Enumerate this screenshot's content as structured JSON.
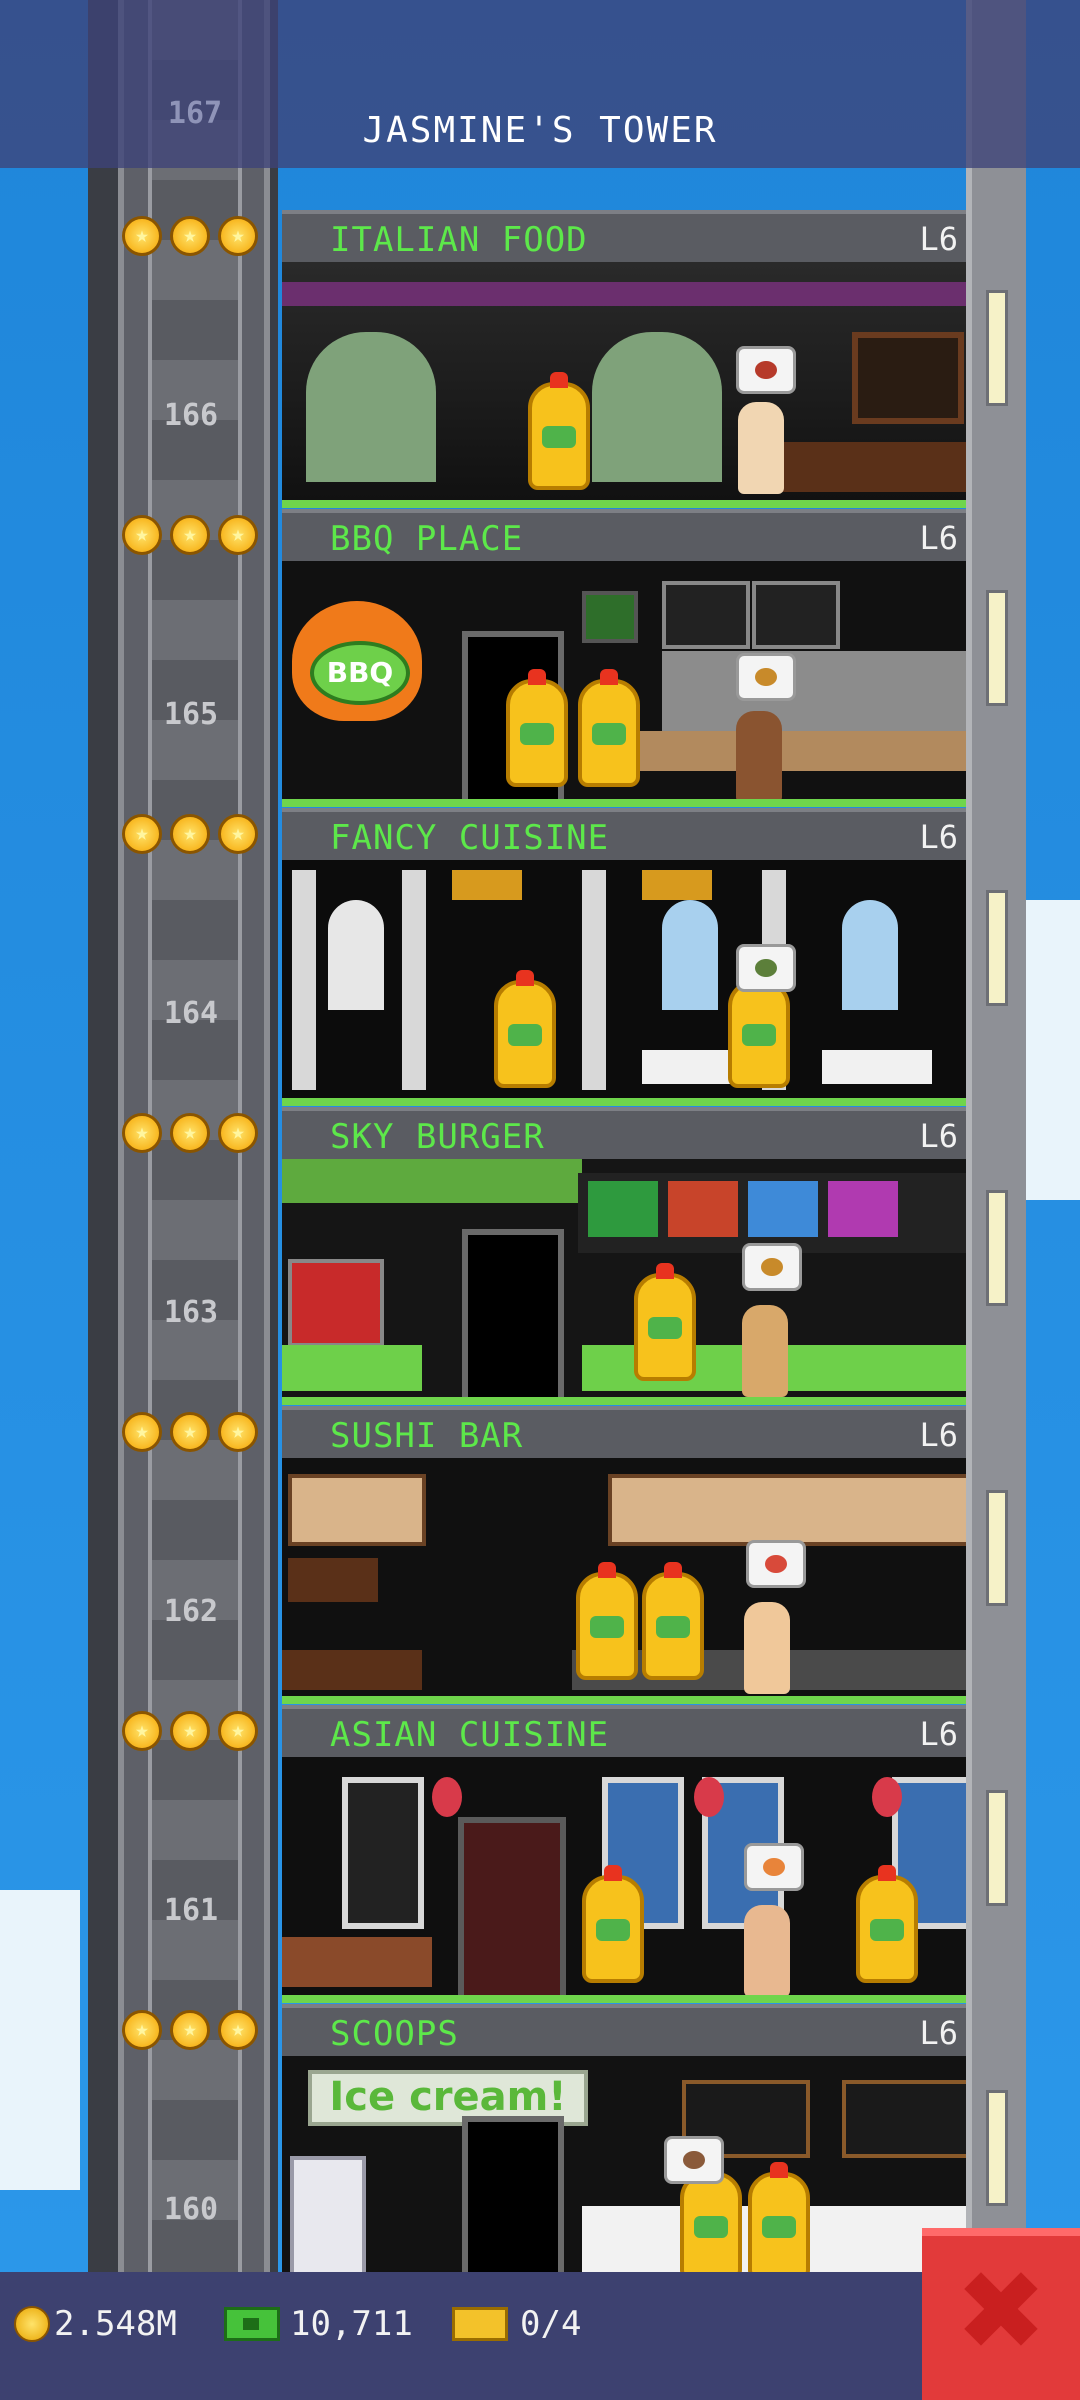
{
  "header": {
    "title": "JASMINE'S TOWER",
    "top_floor_number": "167"
  },
  "floors": [
    {
      "number": "166",
      "name": "ITALIAN FOOD",
      "level": "L6",
      "stars": 3
    },
    {
      "number": "165",
      "name": "BBQ PLACE",
      "level": "L6",
      "stars": 3
    },
    {
      "number": "164",
      "name": "FANCY CUISINE",
      "level": "L6",
      "stars": 3
    },
    {
      "number": "163",
      "name": "SKY BURGER",
      "level": "L6",
      "stars": 3
    },
    {
      "number": "162",
      "name": "SUSHI BAR",
      "level": "L6",
      "stars": 3
    },
    {
      "number": "161",
      "name": "ASIAN CUISINE",
      "level": "L6",
      "stars": 3
    },
    {
      "number": "160",
      "name": "SCOOPS",
      "level": "L6",
      "stars": 3
    }
  ],
  "signs": {
    "bbq": "BBQ",
    "ice_cream": "Ice cream!"
  },
  "status_bar": {
    "coins": "2.548M",
    "bux": "10,711",
    "tickets": "0/4"
  },
  "icons": {
    "coin": "coin-icon",
    "bux": "bux-icon",
    "ticket": "ticket-icon",
    "close": "close-icon",
    "star": "star-icon"
  },
  "colors": {
    "floor_name": "#5de84a",
    "close_button": "#e23a3a",
    "top_bar": "#3e4278",
    "sky": "#2a8fe0"
  }
}
